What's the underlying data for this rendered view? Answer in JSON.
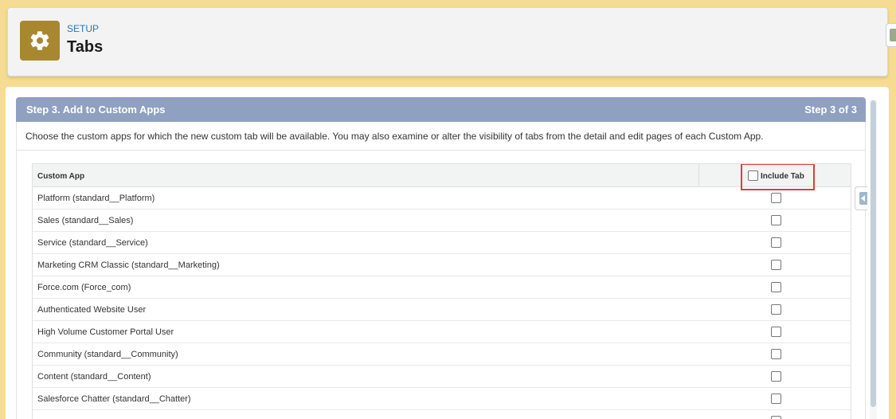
{
  "header": {
    "eyebrow": "SETUP",
    "title": "Tabs",
    "icon": "gear-icon",
    "icon_bg": "#a8882f"
  },
  "step": {
    "title": "Step 3. Add to Custom Apps",
    "counter": "Step 3 of 3",
    "description": "Choose the custom apps for which the new custom tab will be available. You may also examine or alter the visibility of tabs from the detail and edit pages of each Custom App."
  },
  "table": {
    "col_app": "Custom App",
    "col_include": "Include Tab",
    "rows": [
      {
        "name": "Platform (standard__Platform)",
        "checked": false
      },
      {
        "name": "Sales (standard__Sales)",
        "checked": false
      },
      {
        "name": "Service (standard__Service)",
        "checked": false
      },
      {
        "name": "Marketing CRM Classic (standard__Marketing)",
        "checked": false
      },
      {
        "name": "Force.com (Force_com)",
        "checked": false
      },
      {
        "name": "Authenticated Website User",
        "checked": false
      },
      {
        "name": "High Volume Customer Portal User",
        "checked": false
      },
      {
        "name": "Community (standard__Community)",
        "checked": false
      },
      {
        "name": "Content (standard__Content)",
        "checked": false
      },
      {
        "name": "Salesforce Chatter (standard__Chatter)",
        "checked": false
      },
      {
        "name": "",
        "checked": false
      }
    ]
  },
  "colors": {
    "page_bg": "#f6dc92",
    "step_bar": "#8fa0c1",
    "highlight": "#d9403a",
    "link": "#2a74b8"
  }
}
